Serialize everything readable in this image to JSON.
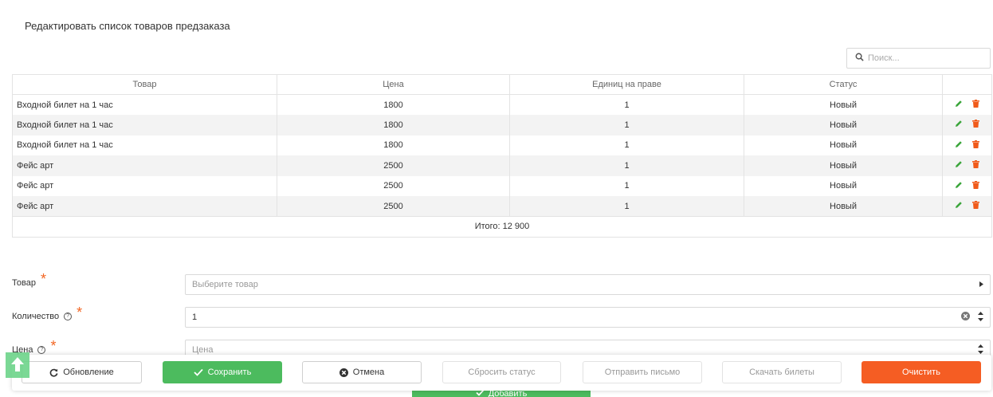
{
  "page": {
    "title": "Редактировать список товаров предзаказа"
  },
  "search": {
    "placeholder": "Поиск..."
  },
  "table": {
    "headers": [
      "Товар",
      "Цена",
      "Единиц на праве",
      "Статус",
      ""
    ],
    "rows": [
      {
        "name": "Входной билет на 1 час",
        "price": "1800",
        "units": "1",
        "status": "Новый"
      },
      {
        "name": "Входной билет на 1 час",
        "price": "1800",
        "units": "1",
        "status": "Новый"
      },
      {
        "name": "Входной билет на 1 час",
        "price": "1800",
        "units": "1",
        "status": "Новый"
      },
      {
        "name": "Фейс арт",
        "price": "2500",
        "units": "1",
        "status": "Новый"
      },
      {
        "name": "Фейс арт",
        "price": "2500",
        "units": "1",
        "status": "Новый"
      },
      {
        "name": "Фейс арт",
        "price": "2500",
        "units": "1",
        "status": "Новый"
      }
    ],
    "total": "Итого: 12 900"
  },
  "form": {
    "product_label": "Товар",
    "product_placeholder": "Выберите товар",
    "quantity_label": "Количество",
    "quantity_value": "1",
    "price_label": "Цена",
    "price_placeholder": "Цена"
  },
  "toolbar": {
    "refresh": "Обновление",
    "save": "Сохранить",
    "cancel": "Отмена",
    "reset_status": "Сбросить статус",
    "send_email": "Отправить письмо",
    "download_tickets": "Скачать билеты",
    "clear": "Очистить"
  },
  "add_button": "Добавить",
  "icons": {
    "edit": "pencil-icon",
    "delete": "trash-icon",
    "search": "search-icon",
    "up": "arrow-up-icon"
  },
  "colors": {
    "green": "#4cbb5e",
    "orange": "#f55d23",
    "edit_icon": "#3aa53a",
    "delete_icon": "#f05a1a"
  }
}
